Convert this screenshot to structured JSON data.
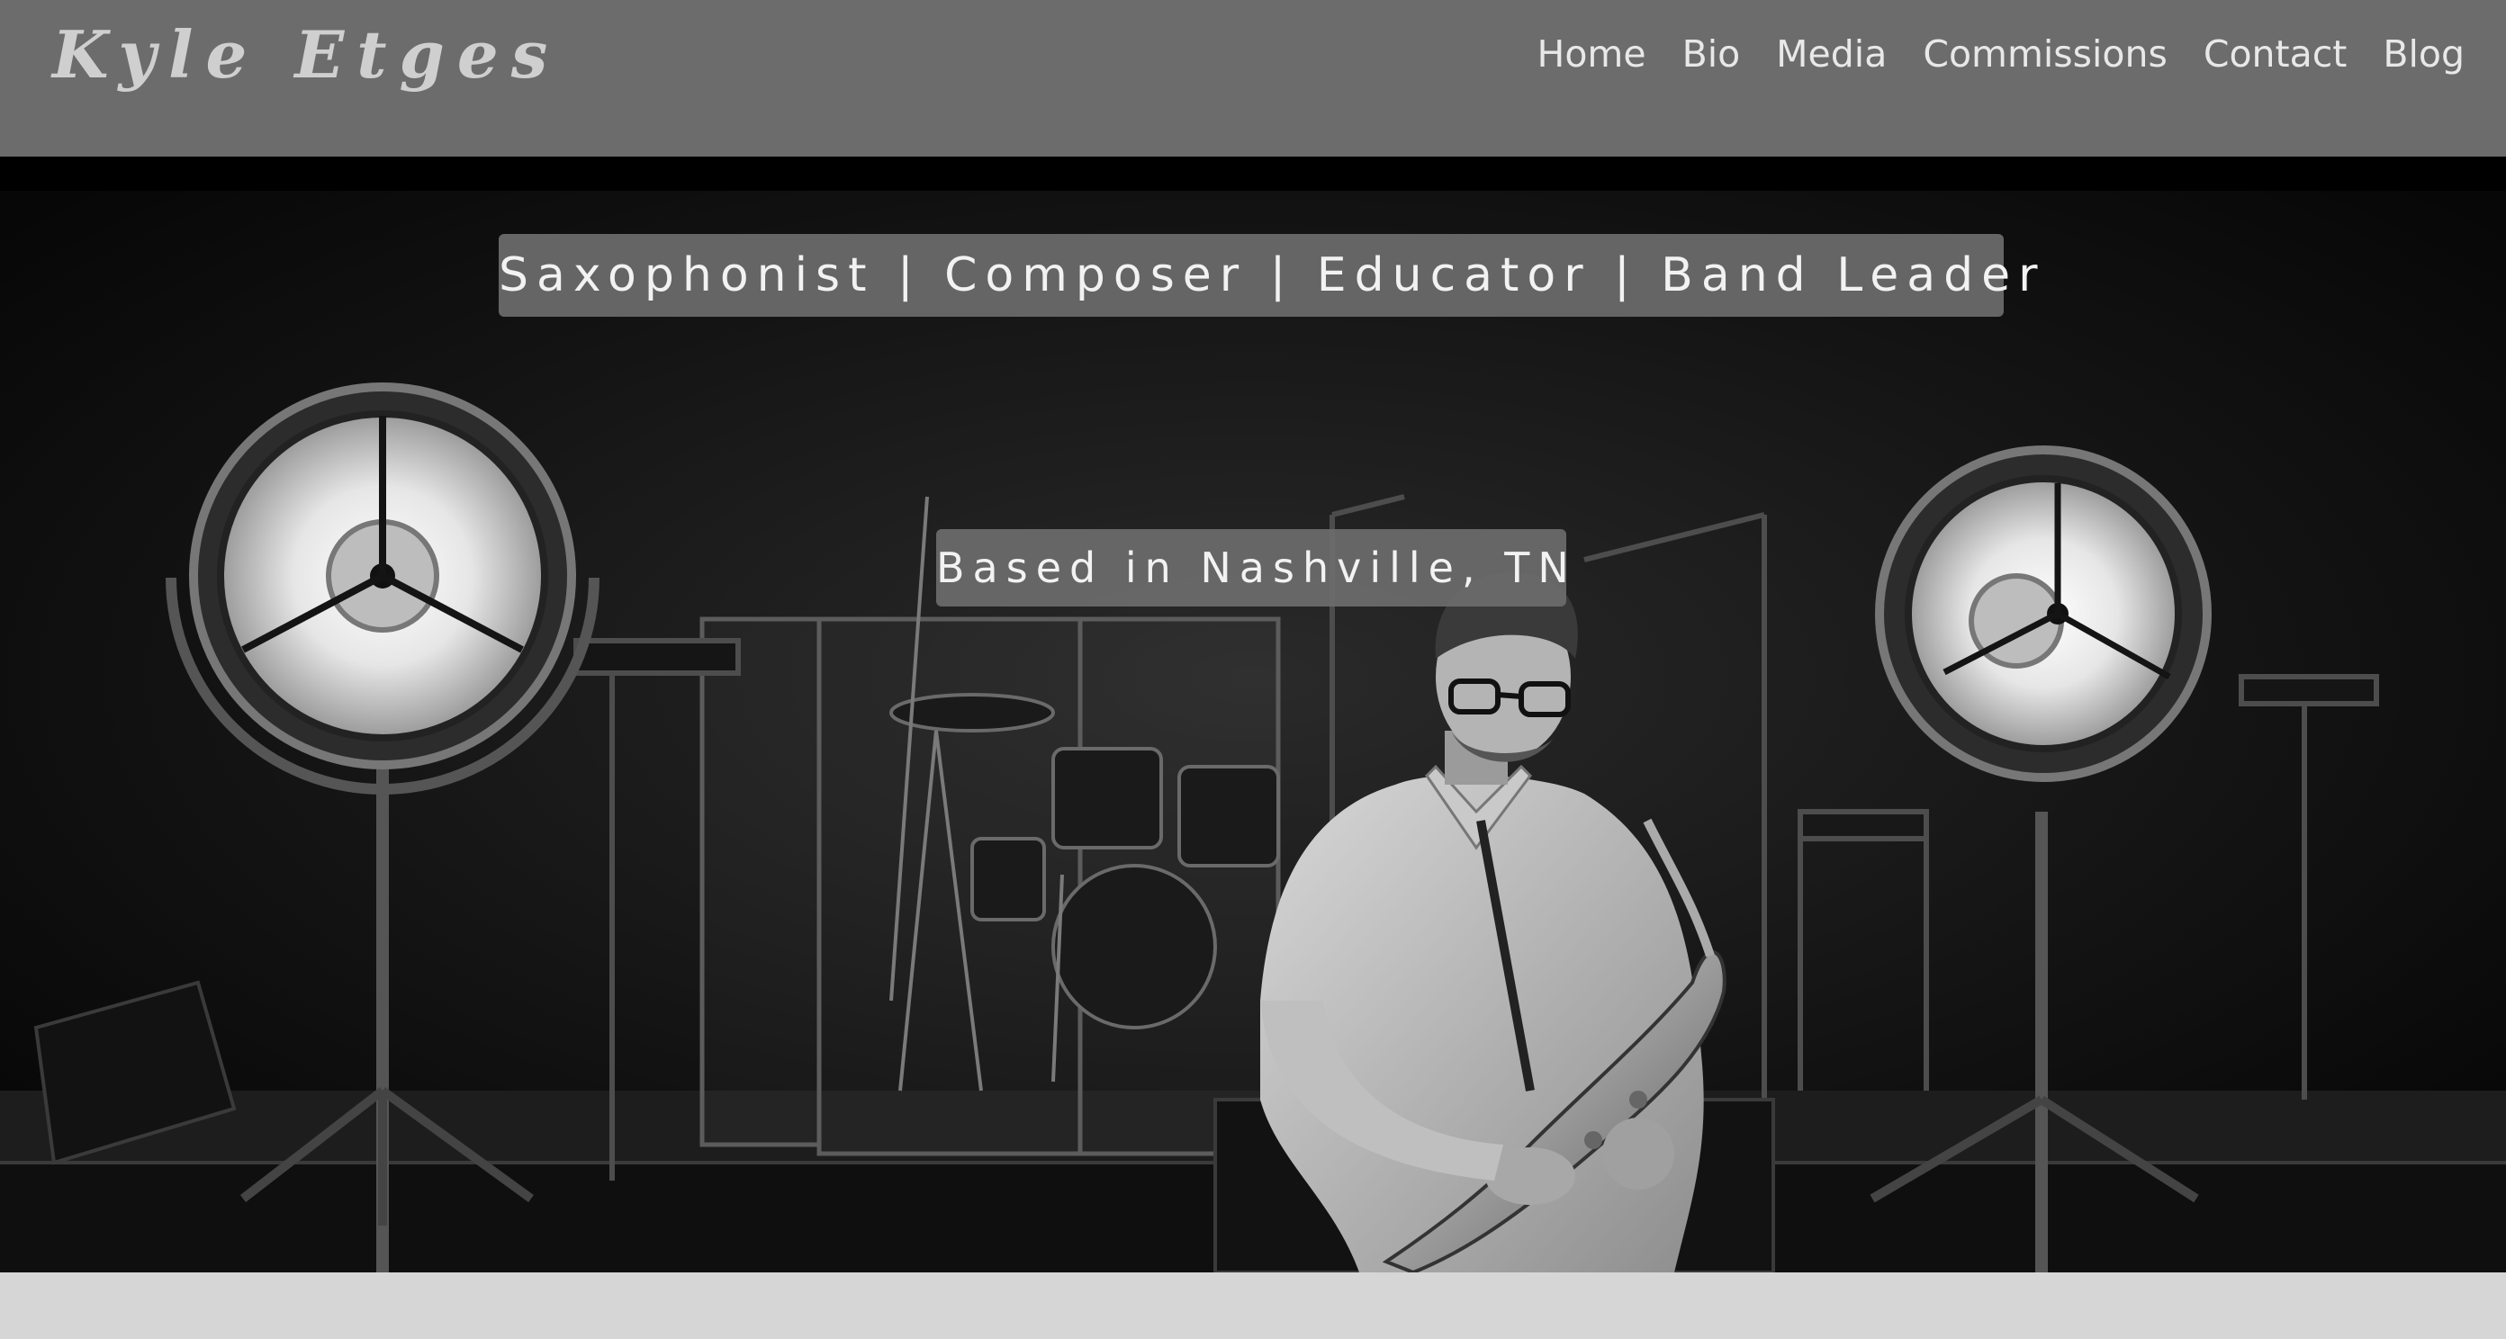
{
  "header": {
    "logo": "Kyle Etges",
    "nav": [
      "Home",
      "Bio",
      "Media",
      "Commissions",
      "Contact",
      "Blog"
    ]
  },
  "hero": {
    "tagline": "Saxophonist | Composer | Educator | Band Leader",
    "location": "Based in Nashville, TN",
    "photo_subject": "saxophonist-on-stage-photo"
  },
  "colors": {
    "header_bg": "#6c6c6c",
    "banner_bg": "#6c6c6c",
    "page_bg": "#d6d6d6",
    "logo_text": "#cfcfcf",
    "nav_text": "#e8e8e8"
  }
}
